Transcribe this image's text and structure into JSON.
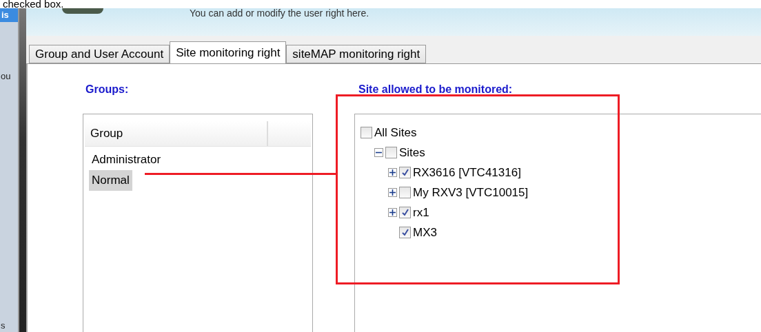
{
  "caption": "checked box.",
  "side_strip": {
    "top": "is",
    "middle": "ou",
    "bottom": "s"
  },
  "header": {
    "text": "You can add or modify the user right here."
  },
  "tabs": [
    {
      "label": "Group and User Account",
      "selected": false
    },
    {
      "label": "Site monitoring right",
      "selected": true
    },
    {
      "label": "siteMAP monitoring right",
      "selected": false
    }
  ],
  "groups": {
    "title": "Groups:",
    "columns": [
      "Group"
    ],
    "rows": [
      {
        "name": "Administrator",
        "selected": false
      },
      {
        "name": "Normal",
        "selected": true
      }
    ]
  },
  "sites": {
    "title": "Site allowed to be monitored:",
    "tree": [
      {
        "label": "All Sites",
        "kind": "root",
        "checked": false,
        "expanded": true,
        "children": [
          {
            "label": "Sites",
            "kind": "branch",
            "checked": false,
            "expanded": true,
            "children": [
              {
                "label": "RX3616 [VTC41316]",
                "kind": "branch",
                "checked": true,
                "expanded": false
              },
              {
                "label": "My RXV3 [VTC10015]",
                "kind": "branch",
                "checked": false,
                "expanded": false
              },
              {
                "label": "rx1",
                "kind": "branch",
                "checked": true,
                "expanded": false
              },
              {
                "label": "MX3",
                "kind": "leaf",
                "checked": true
              }
            ]
          }
        ]
      }
    ]
  },
  "annotation": {
    "highlight": true
  }
}
